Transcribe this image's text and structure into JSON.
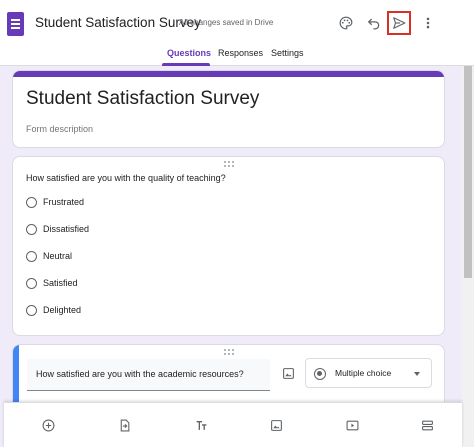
{
  "header": {
    "title": "Student Satisfaction Survey",
    "save_status": "All changes saved in Drive",
    "icons": [
      "palette-icon",
      "undo-icon",
      "send-icon",
      "more-vert-icon"
    ]
  },
  "tabs": [
    {
      "label": "Questions",
      "active": true
    },
    {
      "label": "Responses",
      "active": false
    },
    {
      "label": "Settings",
      "active": false
    }
  ],
  "form": {
    "title": "Student Satisfaction Survey",
    "description_placeholder": "Form description"
  },
  "question1": {
    "text": "How satisfied are you with the quality of teaching?",
    "options": [
      "Frustrated",
      "Dissatisfied",
      "Neutral",
      "Satisfied",
      "Delighted"
    ]
  },
  "question2": {
    "text": "How satisfied are you with the academic resources?",
    "type": "Multiple choice"
  },
  "bottom_toolbar": {
    "icons": [
      "add-question-icon",
      "import-questions-icon",
      "add-title-icon",
      "add-image-icon",
      "add-video-icon",
      "add-section-icon"
    ]
  },
  "colors": {
    "accent": "#673ab7",
    "focus": "#4285f4",
    "highlight": "#d93025",
    "background": "#f0ebf8"
  }
}
